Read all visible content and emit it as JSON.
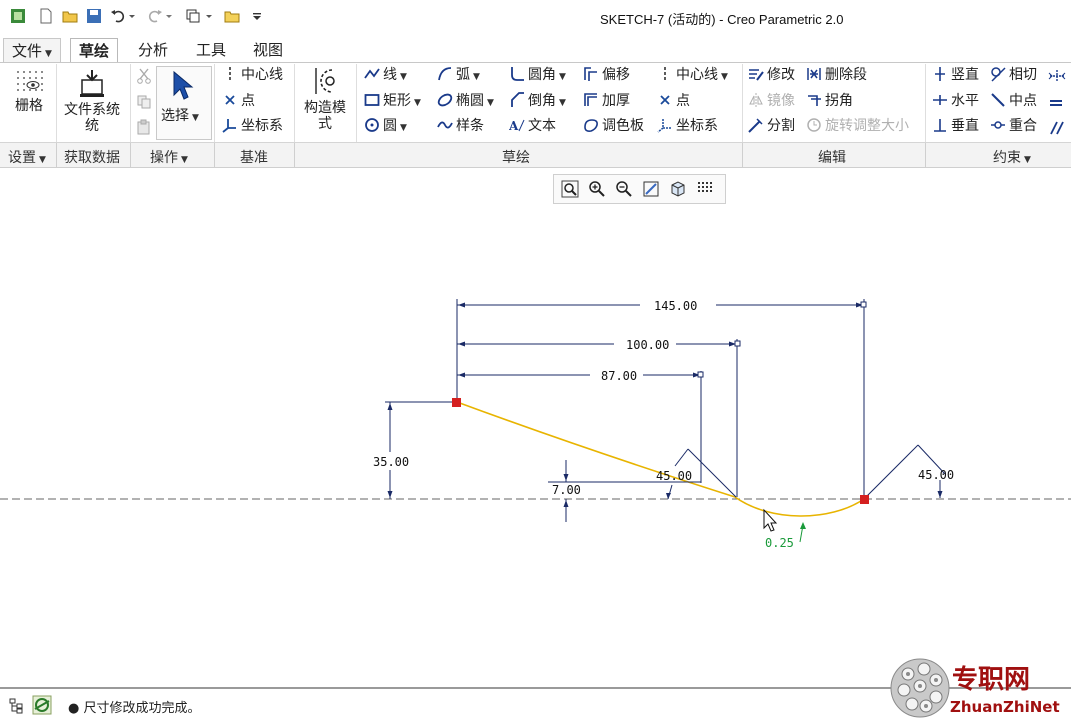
{
  "window": {
    "title": "SKETCH-7 (活动的) - Creo Parametric 2.0"
  },
  "tabs": [
    {
      "label": "文件"
    },
    {
      "label": "草绘"
    },
    {
      "label": "分析"
    },
    {
      "label": "工具"
    },
    {
      "label": "视图"
    }
  ],
  "ribbon": {
    "setup": {
      "grid_label": "栅格"
    },
    "get_data": {
      "file_system_label": "文件系统",
      "file_system_label_2": "统"
    },
    "operations": {
      "select_label": "选择"
    },
    "datum": {
      "centerline": "中心线",
      "point": "点",
      "coord_sys": "坐标系"
    },
    "construction_mode": {
      "label_1": "构造模",
      "label_2": "式"
    },
    "sketch": {
      "line": "线",
      "rectangle": "矩形",
      "circle": "圆",
      "arc": "弧",
      "ellipse": "椭圆",
      "spline": "样条",
      "fillet": "圆角",
      "chamfer": "倒角",
      "text": "文本",
      "offset": "偏移",
      "thicken": "加厚",
      "palette": "调色板",
      "centerline": "中心线",
      "point": "点",
      "coord_sys": "坐标系"
    },
    "editing": {
      "modify": "修改",
      "delete_segment": "删除段",
      "mirror": "镜像",
      "corner": "拐角",
      "divide": "分割",
      "rotate_resize": "旋转调整大小"
    },
    "constrain": {
      "vertical": "竖直",
      "tangent": "相切",
      "horizontal": "水平",
      "midpoint": "中点",
      "perpendicular": "垂直",
      "coincident": "重合"
    }
  },
  "groups": {
    "setup": "设置",
    "get_data": "获取数据",
    "operations": "操作",
    "datum": "基准",
    "sketch": "草绘",
    "editing": "编辑",
    "constrain": "约束"
  },
  "dimensions": {
    "d145": "145.00",
    "d100": "100.00",
    "d87": "87.00",
    "d35": "35.00",
    "d7": "7.00",
    "a45_left": "45.00",
    "a45_right": "45.00",
    "r025": "0.25"
  },
  "status": {
    "message": "● 尺寸修改成功完成。"
  },
  "watermark": {
    "site_text": "专职网",
    "url_text": "ZhuanZhiNet"
  },
  "colors": {
    "accent_sketch": "#e8b400",
    "dim_line": "#1a2a66",
    "point_red": "#d42020",
    "tangent_green": "#1a9a3a"
  }
}
